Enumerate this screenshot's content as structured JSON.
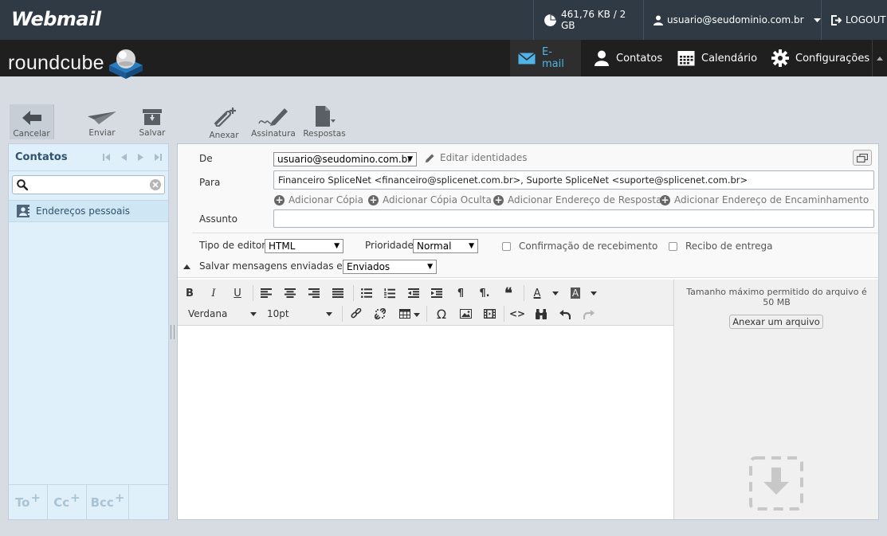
{
  "topbar": {
    "brand": "Webmail",
    "quota": "461,76 KB / 2 GB",
    "user": "usuario@seudominio.com.br",
    "logout": "LOGOUT"
  },
  "header": {
    "logo": "roundcube",
    "tabs": [
      {
        "label": "E-mail",
        "icon": "envelope-icon"
      },
      {
        "label": "Contatos",
        "icon": "person-icon"
      },
      {
        "label": "Calendário",
        "icon": "calendar-icon"
      },
      {
        "label": "Configurações",
        "icon": "gear-icon"
      }
    ]
  },
  "toolbar": {
    "cancel": "Cancelar",
    "send": "Enviar",
    "save": "Salvar",
    "attach": "Anexar",
    "signature": "Assinatura",
    "responses": "Respostas"
  },
  "contacts": {
    "title": "Contatos",
    "search_placeholder": "",
    "addressbook": "Endereços pessoais",
    "recipient_buttons": [
      "To",
      "Cc",
      "Bcc"
    ]
  },
  "compose": {
    "from_label": "De",
    "from_value": "usuario@seudomino.com.br",
    "edit_identities": "Editar identidades",
    "to_label": "Para",
    "to_value": "Financeiro SpliceNet <financeiro@splicenet.com.br>, Suporte SpliceNet <suporte@splicenet.com.br>",
    "add_links": [
      "Adicionar Cópia",
      "Adicionar Cópia Oculta",
      "Adicionar Endereço de Resposta",
      "Adicionar Endereço de Encaminhamento"
    ],
    "subject_label": "Assunto",
    "subject_value": "",
    "editor_type_label": "Tipo de editor",
    "editor_type_value": "HTML",
    "priority_label": "Prioridade",
    "priority_value": "Normal",
    "read_receipt": "Confirmação de recebimento",
    "delivery_receipt": "Recibo de entrega",
    "save_sent_label": "Salvar mensagens enviadas em",
    "save_sent_value": "Enviados"
  },
  "editor": {
    "font": "Verdana",
    "size": "10pt",
    "bold": "B",
    "italic": "I",
    "underline": "U",
    "color_a": "A",
    "bg_a": "A"
  },
  "attachments": {
    "info": "Tamanho máximo permitido do arquivo é 50 MB",
    "button": "Anexar um arquivo"
  },
  "colors": {
    "topbar": "#2f3a44",
    "header": "#1f1f1f",
    "active_tab": "#4fb4e8",
    "contacts_bg": "#dff0fb"
  }
}
